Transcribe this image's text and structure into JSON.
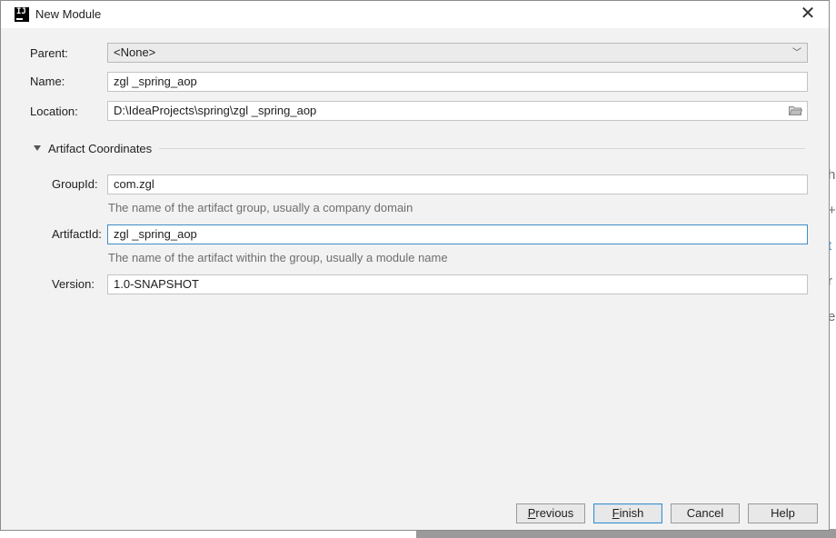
{
  "window": {
    "title": "New Module",
    "app_icon_letters": "IJ"
  },
  "form": {
    "parent": {
      "label": "Parent:",
      "value": "<None>"
    },
    "name": {
      "label": "Name:",
      "value": "zgl _spring_aop"
    },
    "location": {
      "label": "Location:",
      "value": "D:\\IdeaProjects\\spring\\zgl _spring_aop"
    }
  },
  "artifact": {
    "section_title": "Artifact Coordinates",
    "group_id": {
      "label": "GroupId:",
      "value": "com.zgl",
      "hint": "The name of the artifact group, usually a company domain"
    },
    "artifact_id": {
      "label": "ArtifactId:",
      "value": "zgl _spring_aop",
      "hint": "The name of the artifact within the group, usually a module name"
    },
    "version": {
      "label": "Version:",
      "value": "1.0-SNAPSHOT"
    }
  },
  "buttons": {
    "previous": "Previous",
    "finish": "Finish",
    "cancel": "Cancel",
    "help": "Help"
  },
  "background_fragments": [
    "h",
    "+",
    "t",
    "r",
    "e"
  ],
  "icons": {
    "close": "close-icon",
    "folder": "folder-icon",
    "dropdown": "chevron-down-icon",
    "collapse": "triangle-down-icon"
  },
  "colors": {
    "focus_border": "#3d8ec8",
    "dialog_bg": "#f2f2f2",
    "hint_text": "#6e6e6e"
  }
}
